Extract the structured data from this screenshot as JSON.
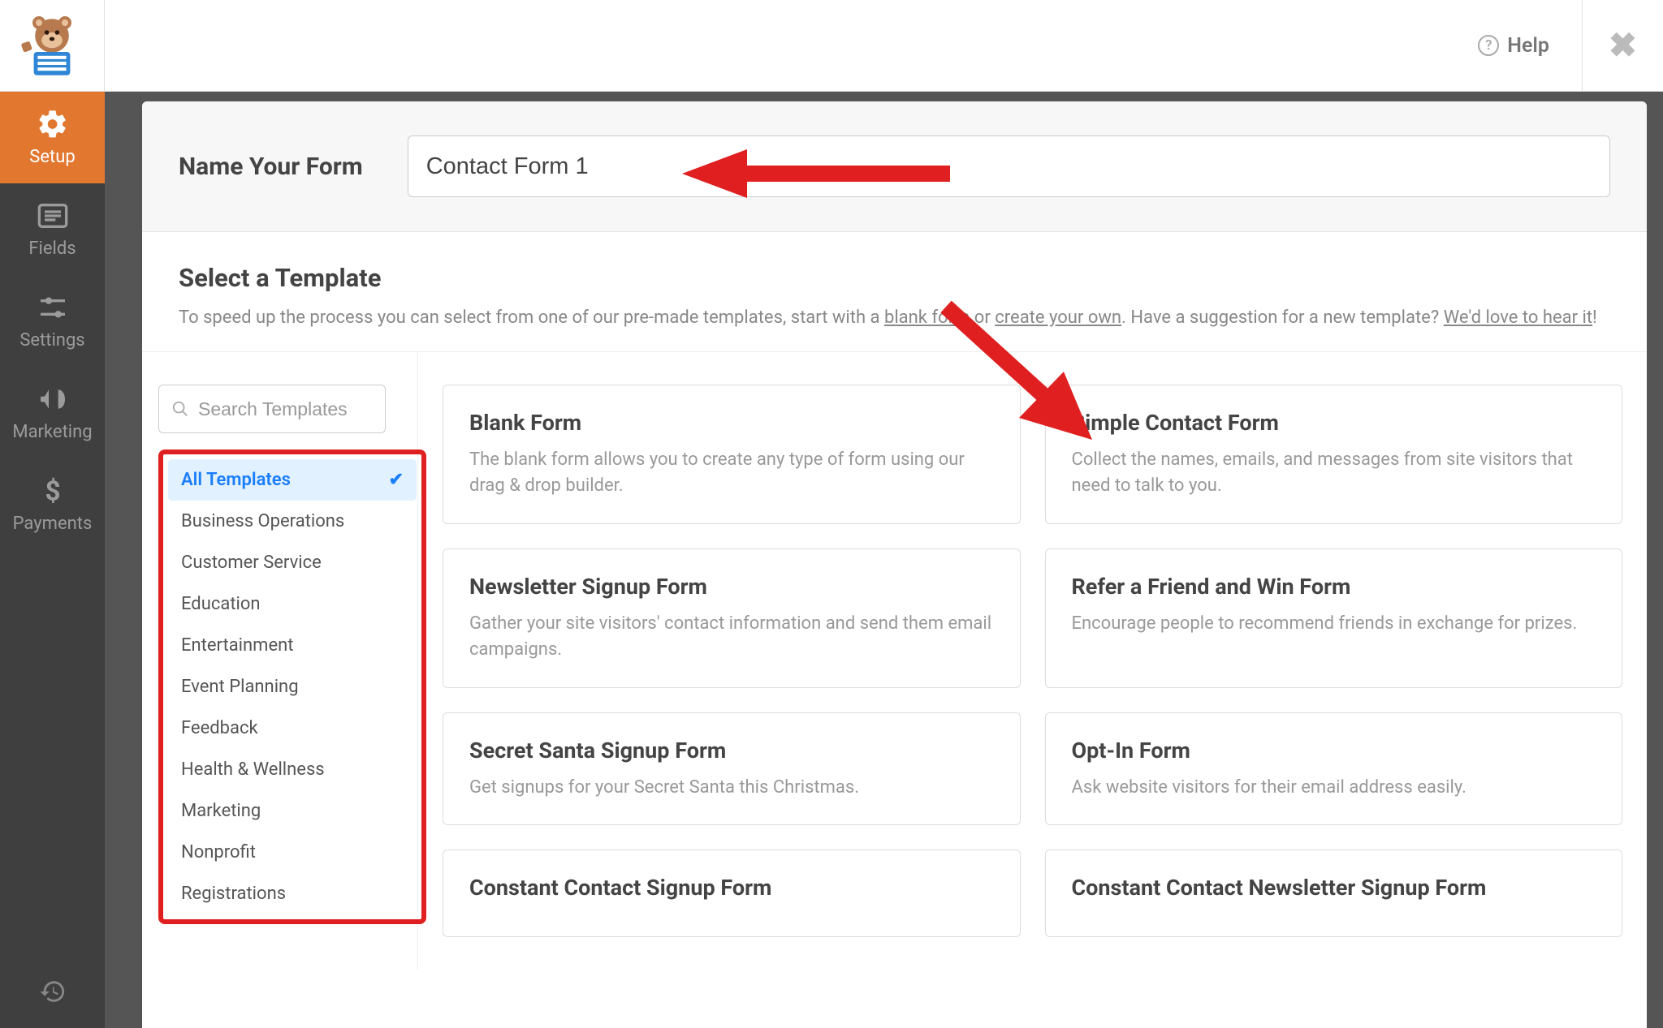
{
  "header": {
    "help_label": "Help"
  },
  "sidebar": {
    "items": [
      {
        "label": "Setup"
      },
      {
        "label": "Fields"
      },
      {
        "label": "Settings"
      },
      {
        "label": "Marketing"
      },
      {
        "label": "Payments"
      }
    ]
  },
  "name_form": {
    "label": "Name Your Form",
    "value": "Contact Form 1"
  },
  "template_section": {
    "heading": "Select a Template",
    "desc_prefix": "To speed up the process you can select from one of our pre-made templates, start with a ",
    "blank_link": "blank form",
    "desc_mid": " or ",
    "create_link": "create your own",
    "desc_mid2": ". Have a suggestion for a new template? ",
    "hear_link": "We'd love to hear it",
    "desc_end": "!"
  },
  "search": {
    "placeholder": "Search Templates"
  },
  "categories": [
    "All Templates",
    "Business Operations",
    "Customer Service",
    "Education",
    "Entertainment",
    "Event Planning",
    "Feedback",
    "Health & Wellness",
    "Marketing",
    "Nonprofit",
    "Registrations"
  ],
  "templates": [
    {
      "title": "Blank Form",
      "desc": "The blank form allows you to create any type of form using our drag & drop builder."
    },
    {
      "title": "Simple Contact Form",
      "desc": "Collect the names, emails, and messages from site visitors that need to talk to you."
    },
    {
      "title": "Newsletter Signup Form",
      "desc": "Gather your site visitors' contact information and send them email campaigns."
    },
    {
      "title": "Refer a Friend and Win Form",
      "desc": "Encourage people to recommend friends in exchange for prizes."
    },
    {
      "title": "Secret Santa Signup Form",
      "desc": "Get signups for your Secret Santa this Christmas."
    },
    {
      "title": "Opt-In Form",
      "desc": "Ask website visitors for their email address easily."
    },
    {
      "title": "Constant Contact Signup Form",
      "desc": ""
    },
    {
      "title": "Constant Contact Newsletter Signup Form",
      "desc": ""
    }
  ]
}
